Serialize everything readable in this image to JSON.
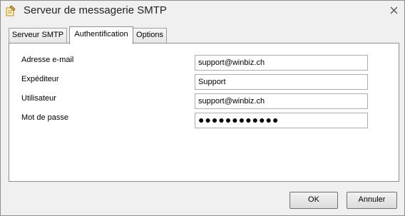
{
  "window": {
    "title": "Serveur de messagerie SMTP",
    "app_icon": "pencil-note-icon",
    "close_icon": "close-icon"
  },
  "tabs": [
    {
      "label": "Serveur SMTP",
      "active": false
    },
    {
      "label": "Authentification",
      "active": true
    },
    {
      "label": "Options",
      "active": false
    }
  ],
  "form": {
    "email_label": "Adresse e-mail",
    "email_value": "support@winbiz.ch",
    "sender_label": "Expéditeur",
    "sender_value": "Support",
    "user_label": "Utilisateur",
    "user_value": "support@winbiz.ch",
    "password_label": "Mot de passe",
    "password_value": "●●●●●●●●●●●●"
  },
  "buttons": {
    "ok_label": "OK",
    "cancel_label": "Annuler"
  }
}
